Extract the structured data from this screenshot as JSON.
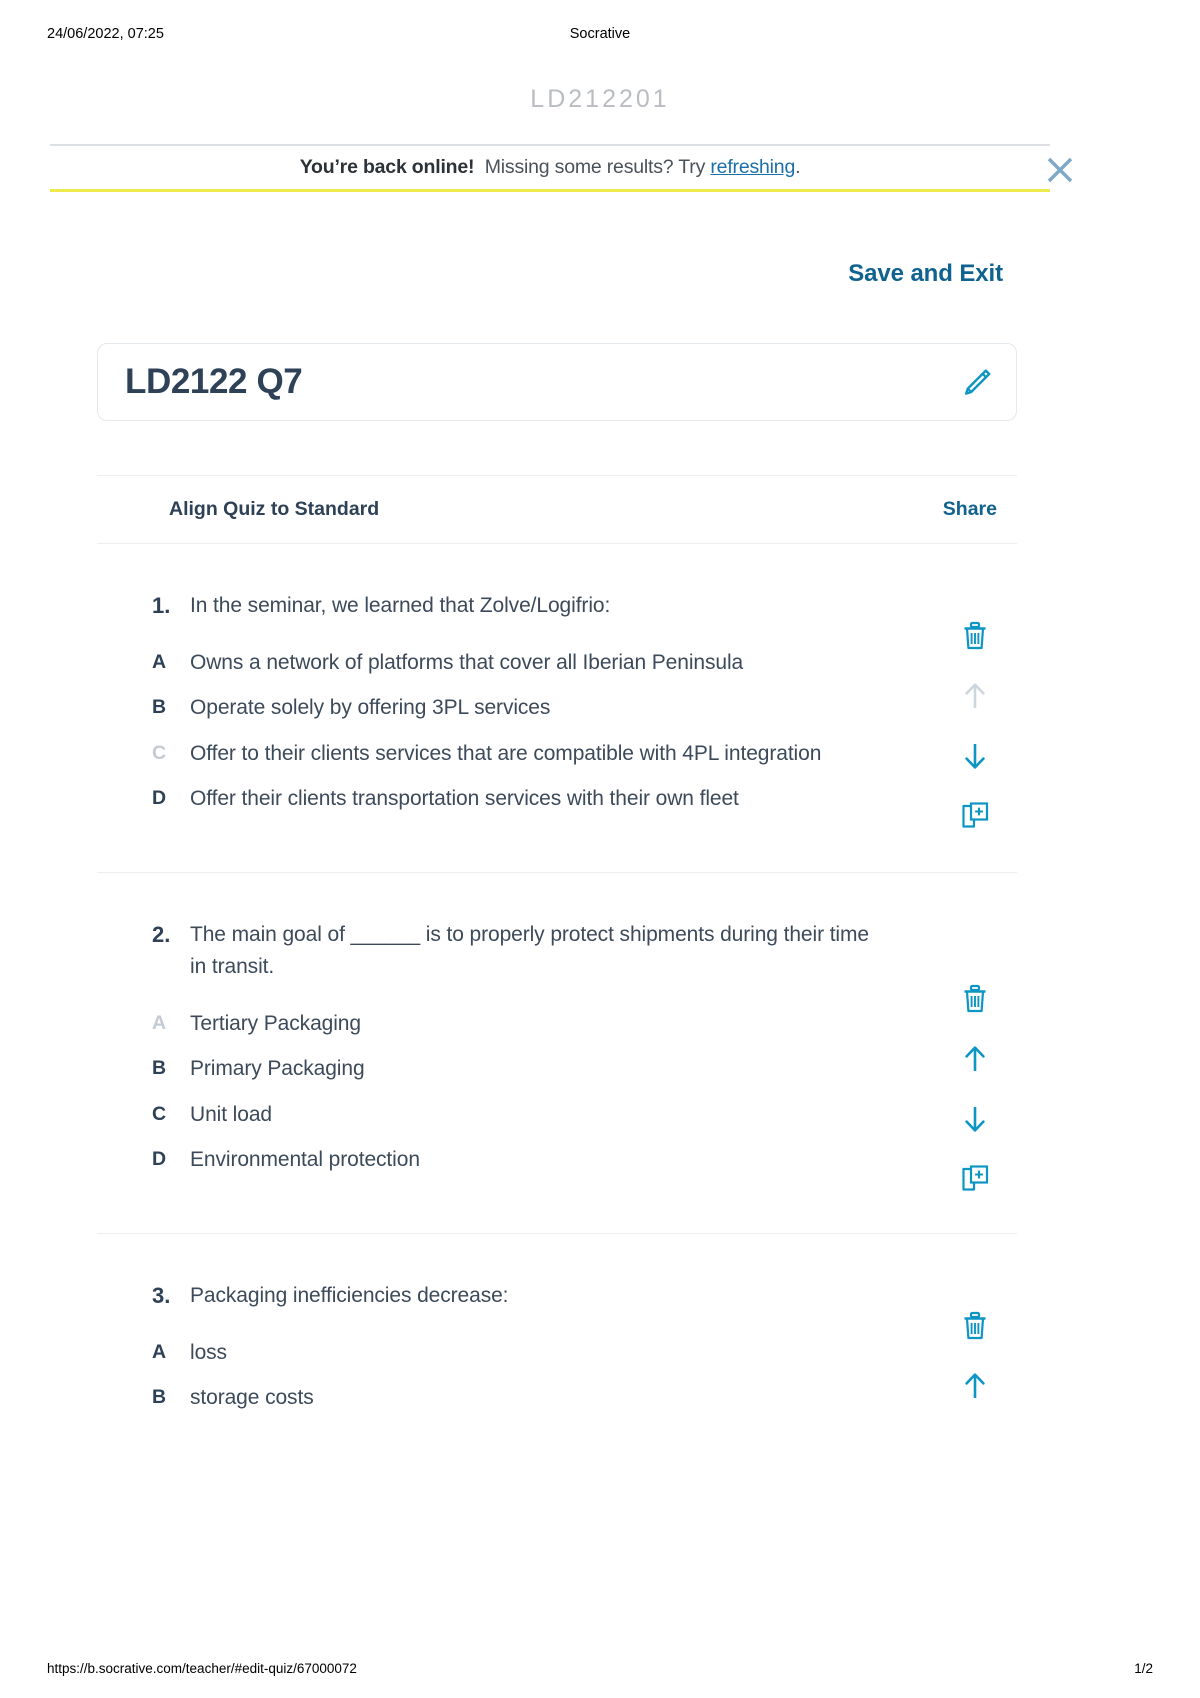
{
  "print": {
    "date": "24/06/2022, 07:25",
    "doc_title": "Socrative",
    "footer_url": "https://b.socrative.com/teacher/#edit-quiz/67000072",
    "page_number": "1/2"
  },
  "room_code": "LD212201",
  "banner": {
    "bold_text": "You’re back online!",
    "message_pre": "Missing some results? Try ",
    "link_text": "refreshing",
    "message_post": ".",
    "close_icon": "close-icon",
    "border_bottom_color": "#ecea4c",
    "close_icon_color": "#7ea8c6"
  },
  "header": {
    "save_and_exit": "Save and Exit"
  },
  "quiz": {
    "title": "LD2122 Q7",
    "edit_icon": "pencil-icon",
    "align_standard_label": "Align Quiz to Standard",
    "share_label": "Share"
  },
  "colors": {
    "accent_cyan": "#0d95c4",
    "accent_dark_blue": "#10628f",
    "text_navy": "#2e4156",
    "text_body": "#3c4a5a",
    "muted": "#c4cbd2",
    "banner_yellow": "#ecea4c"
  },
  "actions": {
    "delete_icon": "trash-icon",
    "move_up_icon": "arrow-up-icon",
    "move_down_icon": "arrow-down-icon",
    "duplicate_icon": "duplicate-icon"
  },
  "questions": [
    {
      "number": "1.",
      "text": "In the seminar, we learned that Zolve/Logifrio:",
      "answers": [
        {
          "letter": "A",
          "muted": false,
          "text": "Owns a network of platforms that cover all Iberian Peninsula"
        },
        {
          "letter": "B",
          "muted": false,
          "text": "Operate solely by offering 3PL services"
        },
        {
          "letter": "C",
          "muted": true,
          "text": "Offer to their clients services that are compatible with 4PL integration"
        },
        {
          "letter": "D",
          "muted": false,
          "text": "Offer their clients transportation services with their own fleet"
        }
      ],
      "up_enabled": false,
      "down_enabled": true
    },
    {
      "number": "2.",
      "text": "The main goal of ______ is to properly protect shipments during their time in transit.",
      "answers": [
        {
          "letter": "A",
          "muted": true,
          "text": "Tertiary Packaging"
        },
        {
          "letter": "B",
          "muted": false,
          "text": "Primary Packaging"
        },
        {
          "letter": "C",
          "muted": false,
          "text": "Unit load"
        },
        {
          "letter": "D",
          "muted": false,
          "text": "Environmental protection"
        }
      ],
      "up_enabled": true,
      "down_enabled": true
    },
    {
      "number": "3.",
      "text": "Packaging inefficiencies decrease:",
      "answers": [
        {
          "letter": "A",
          "muted": false,
          "text": "loss"
        },
        {
          "letter": "B",
          "muted": false,
          "text": "storage costs"
        }
      ],
      "up_enabled": true,
      "down_enabled": true
    }
  ]
}
